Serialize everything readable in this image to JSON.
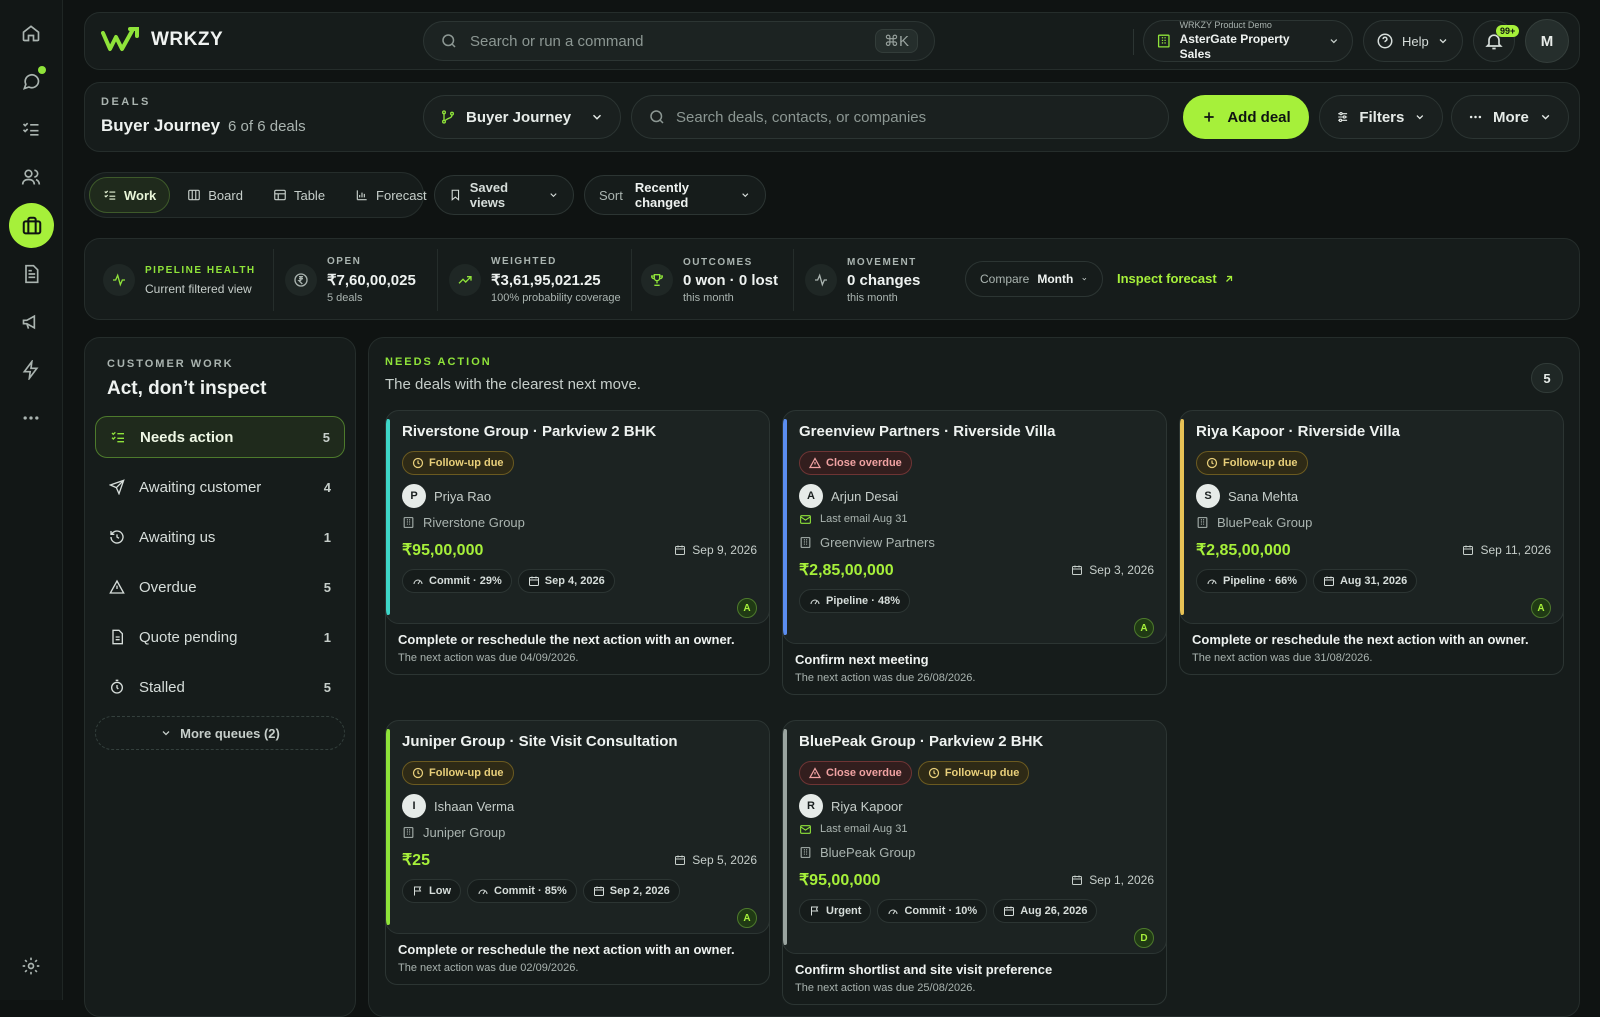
{
  "app": {
    "name": "WRKZY"
  },
  "search": {
    "placeholder": "Search or run a command",
    "shortcut": "⌘K"
  },
  "tenant": {
    "label": "WRKZY Product Demo",
    "name": "AsterGate Property Sales"
  },
  "help": {
    "label": "Help"
  },
  "notifications": {
    "count": "99+"
  },
  "user": {
    "initial": "M"
  },
  "deals_header": {
    "eyebrow": "DEALS",
    "title": "Buyer Journey",
    "count": "6 of 6 deals"
  },
  "pipeline_select": {
    "label": "Buyer Journey"
  },
  "deal_search": {
    "placeholder": "Search deals, contacts, or companies"
  },
  "toolbar": {
    "add_deal": "Add deal",
    "filters": "Filters",
    "more": "More"
  },
  "view_tabs": [
    {
      "label": "Work",
      "icon": "list-check-icon",
      "active": true
    },
    {
      "label": "Board",
      "icon": "board-icon",
      "active": false
    },
    {
      "label": "Table",
      "icon": "table-icon",
      "active": false
    },
    {
      "label": "Forecast",
      "icon": "bar-chart-icon",
      "active": false
    }
  ],
  "saved_views": {
    "label": "Saved views"
  },
  "sort": {
    "label": "Sort",
    "value": "Recently changed"
  },
  "health": {
    "title": "PIPELINE HEALTH",
    "subtitle": "Current filtered view",
    "metrics": [
      {
        "label": "OPEN",
        "value": "₹7,60,00,025",
        "sub": "5 deals",
        "icon": "rupee-icon"
      },
      {
        "label": "WEIGHTED",
        "value": "₹3,61,95,021.25",
        "sub": "100% probability coverage",
        "icon": "trend-up-icon"
      },
      {
        "label": "OUTCOMES",
        "value": "0 won · 0 lost",
        "sub": "this month",
        "icon": "trophy-icon"
      },
      {
        "label": "MOVEMENT",
        "value": "0 changes",
        "sub": "this month",
        "icon": "activity-icon"
      }
    ],
    "compare": {
      "label": "Compare",
      "value": "Month"
    },
    "inspect": "Inspect forecast"
  },
  "sidebar": {
    "eyebrow": "CUSTOMER WORK",
    "title": "Act, don’t inspect",
    "queues": [
      {
        "label": "Needs action",
        "count": "5",
        "icon": "list-check-icon",
        "active": true
      },
      {
        "label": "Awaiting customer",
        "count": "4",
        "icon": "send-icon",
        "active": false
      },
      {
        "label": "Awaiting us",
        "count": "1",
        "icon": "clock-history-icon",
        "active": false
      },
      {
        "label": "Overdue",
        "count": "5",
        "icon": "warning-icon",
        "active": false
      },
      {
        "label": "Quote pending",
        "count": "1",
        "icon": "document-icon",
        "active": false
      },
      {
        "label": "Stalled",
        "count": "5",
        "icon": "timer-icon",
        "active": false
      }
    ],
    "more_queues": "More queues (2)"
  },
  "main": {
    "eyebrow": "NEEDS ACTION",
    "subtitle": "The deals with the clearest next move.",
    "count": "5",
    "cards": [
      {
        "title": "Riverstone Group · Parkview 2 BHK",
        "bar_color": "#3ed6c8",
        "tags": [
          {
            "label": "Follow-up due",
            "kind": "warn"
          }
        ],
        "contact_initial": "P",
        "contact": "Priya Rao",
        "email": "",
        "company": "Riverstone Group",
        "amount": "₹95,00,000",
        "close_date": "Sep 9, 2026",
        "chips": [
          {
            "label": "Commit · 29%",
            "icon": "gauge-icon"
          },
          {
            "label": "Sep 4, 2026",
            "icon": "calendar-icon"
          }
        ],
        "owner": "A",
        "action_title": "Complete or reschedule the next action with an owner.",
        "action_sub": "The next action was due 04/09/2026."
      },
      {
        "title": "Greenview Partners · Riverside Villa",
        "bar_color": "#5b8df0",
        "tags": [
          {
            "label": "Close overdue",
            "kind": "danger"
          }
        ],
        "contact_initial": "A",
        "contact": "Arjun Desai",
        "email": "Last email Aug 31",
        "company": "Greenview Partners",
        "amount": "₹2,85,00,000",
        "close_date": "Sep 3, 2026",
        "chips": [
          {
            "label": "Pipeline · 48%",
            "icon": "gauge-icon"
          }
        ],
        "owner": "A",
        "action_title": "Confirm next meeting",
        "action_sub": "The next action was due 26/08/2026."
      },
      {
        "title": "Riya Kapoor · Riverside Villa",
        "bar_color": "#e8c255",
        "tags": [
          {
            "label": "Follow-up due",
            "kind": "warn"
          }
        ],
        "contact_initial": "S",
        "contact": "Sana Mehta",
        "email": "",
        "company": "BluePeak Group",
        "amount": "₹2,85,00,000",
        "close_date": "Sep 11, 2026",
        "chips": [
          {
            "label": "Pipeline · 66%",
            "icon": "gauge-icon"
          },
          {
            "label": "Aug 31, 2026",
            "icon": "calendar-icon"
          }
        ],
        "owner": "A",
        "action_title": "Complete or reschedule the next action with an owner.",
        "action_sub": "The next action was due 31/08/2026."
      },
      {
        "title": "Juniper Group · Site Visit Consultation",
        "bar_color": "#8fe33a",
        "tags": [
          {
            "label": "Follow-up due",
            "kind": "warn"
          }
        ],
        "contact_initial": "I",
        "contact": "Ishaan Verma",
        "email": "",
        "company": "Juniper Group",
        "amount": "₹25",
        "close_date": "Sep 5, 2026",
        "chips": [
          {
            "label": "Low",
            "icon": "flag-icon"
          },
          {
            "label": "Commit · 85%",
            "icon": "gauge-icon"
          },
          {
            "label": "Sep 2, 2026",
            "icon": "calendar-icon"
          }
        ],
        "owner": "A",
        "action_title": "Complete or reschedule the next action with an owner.",
        "action_sub": "The next action was due 02/09/2026."
      },
      {
        "title": "BluePeak Group · Parkview 2 BHK",
        "bar_color": "#9aa4a0",
        "tags": [
          {
            "label": "Close overdue",
            "kind": "danger"
          },
          {
            "label": "Follow-up due",
            "kind": "warn"
          }
        ],
        "contact_initial": "R",
        "contact": "Riya Kapoor",
        "email": "Last email Aug 31",
        "company": "BluePeak Group",
        "amount": "₹95,00,000",
        "close_date": "Sep 1, 2026",
        "chips": [
          {
            "label": "Urgent",
            "icon": "flag-icon"
          },
          {
            "label": "Commit · 10%",
            "icon": "gauge-icon"
          },
          {
            "label": "Aug 26, 2026",
            "icon": "calendar-icon"
          }
        ],
        "owner": "D",
        "action_title": "Confirm shortlist and site visit preference",
        "action_sub": "The next action was due 25/08/2026."
      }
    ]
  }
}
